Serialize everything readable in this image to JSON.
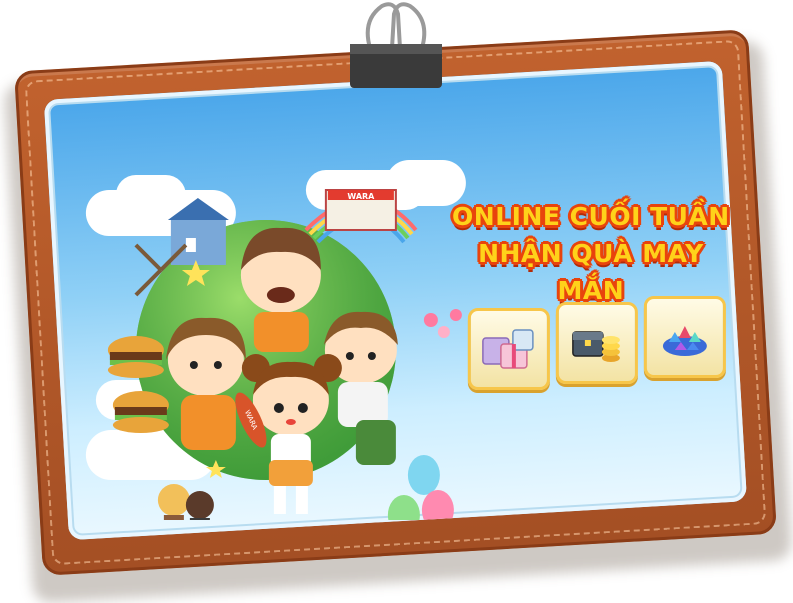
{
  "banner": {
    "title_line1": "ONLINE CUỐI TUẦN",
    "title_line2": "NHẬN QUÀ MAY MẮN",
    "sign_text": "WARA",
    "sausage_text": "WARA"
  },
  "rewards": [
    {
      "name": "gift-box-set",
      "icon": "gift-boxes-icon"
    },
    {
      "name": "gold-coin-chest",
      "icon": "coin-chest-icon"
    },
    {
      "name": "gem-pile",
      "icon": "gems-icon"
    }
  ],
  "colors": {
    "frame": "#b5572a",
    "title_fill": "#ffd21a",
    "title_outline": "#e8440d",
    "sky": "#4aa6ea"
  }
}
